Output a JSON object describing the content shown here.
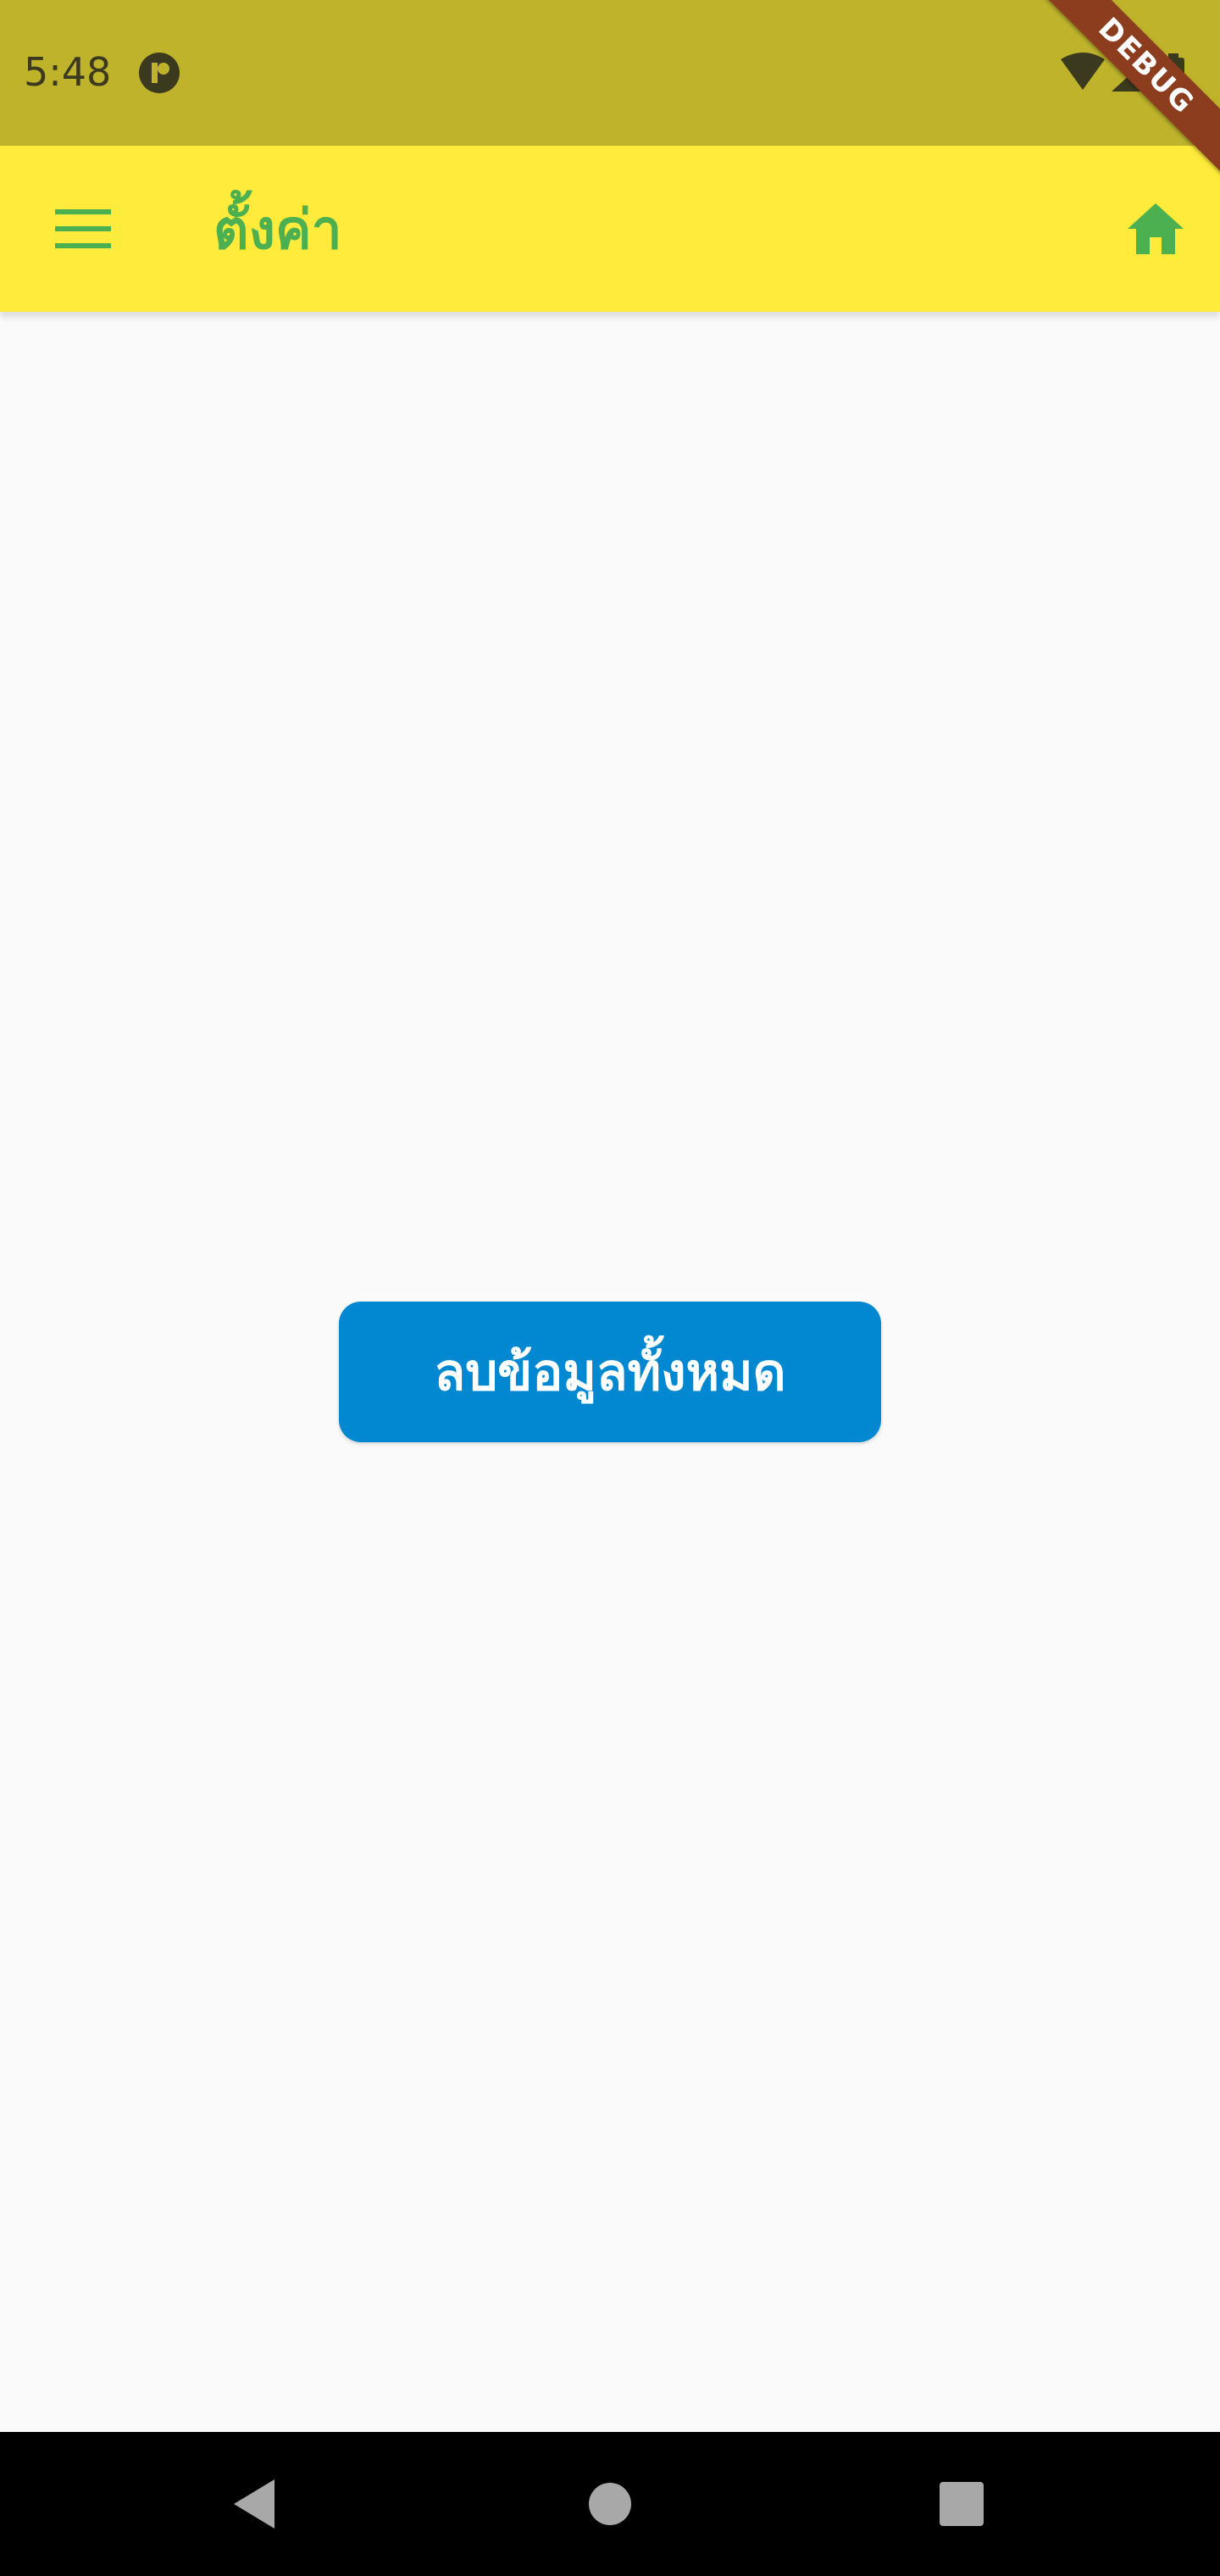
{
  "status_bar": {
    "time": "5:48",
    "icons": [
      "app-notification-icon",
      "wifi-icon",
      "signal-icon",
      "battery-icon"
    ]
  },
  "debug_banner": {
    "label": "DEBUG"
  },
  "app_bar": {
    "title": "ตั้งค่า",
    "menu_icon": "menu-icon",
    "home_icon": "home-icon",
    "background": "#ffeb3b",
    "accent": "#4caf50"
  },
  "main": {
    "clear_button_label": "ลบข้อมูลทั้งหมด",
    "clear_button_color": "#0288d1"
  },
  "nav_bar": {
    "icons": [
      "back-icon",
      "home-circle-icon",
      "recents-icon"
    ]
  }
}
